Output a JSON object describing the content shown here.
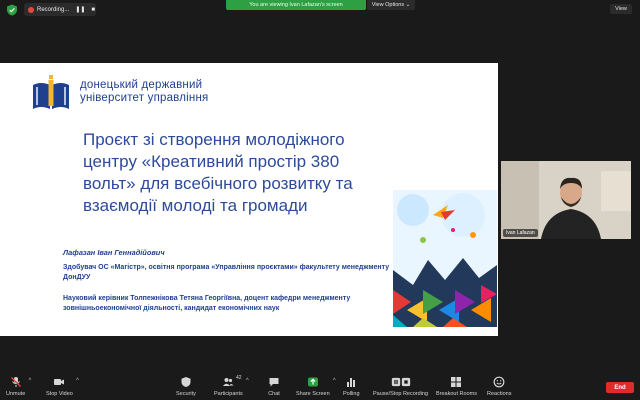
{
  "topbar": {
    "recording_label": "Recording...",
    "viewing_label": "You are viewing Ivan Lafazan's screen",
    "view_options_label": "View Options ⌄",
    "view_label": "View"
  },
  "slide": {
    "university_line1": "донецький державний",
    "university_line2": "університет управління",
    "title_line1": "Проєкт зі створення молодіжного",
    "title_line2": "центру «Креативний простір 380",
    "title_line3": "вольт» для всебічного розвитку та",
    "title_line4": "взаємодії молоді та громади",
    "author": "Лафазан Іван Геннадійович",
    "description1": "Здобувач ОС «Магістр», освітня програма «Управління проєктами» факультету менеджменту ДонДУУ",
    "description2": "Науковий керівник Толпежнікова Тетяна Георгіївна, доцент кафедри менеджменту зовнішньоекономічної діяльності, кандидат економічних наук",
    "brand_color": "#1f3f8f"
  },
  "video": {
    "participant_name": "Ivan Lafazan"
  },
  "toolbar": {
    "unmute": "Unmute",
    "stop_video": "Stop Video",
    "security": "Security",
    "participants": "Participants",
    "participants_count": "42",
    "chat": "Chat",
    "share_screen": "Share Screen",
    "polling": "Polling",
    "pause_stop_recording": "Pause/Stop Recording",
    "breakout_rooms": "Breakout Rooms",
    "reactions": "Reactions",
    "end": "End"
  }
}
